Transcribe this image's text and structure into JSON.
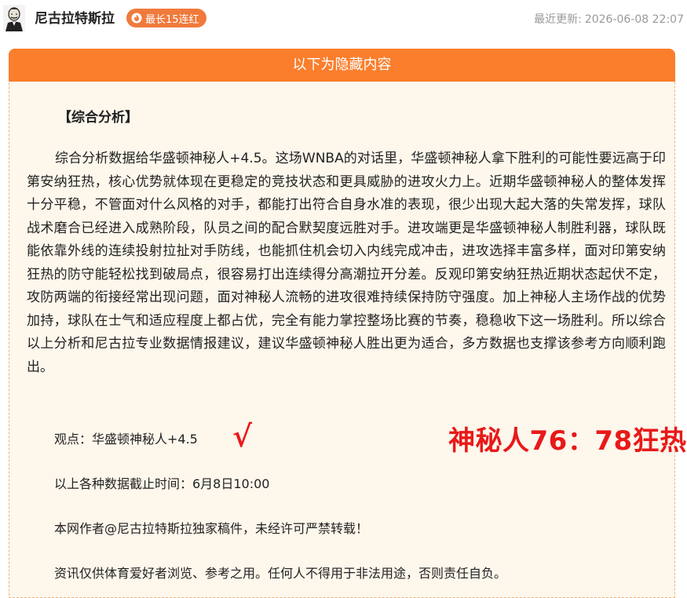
{
  "header": {
    "author": "尼古拉特斯拉",
    "streak_badge": "最长15连红",
    "updated_label": "最近更新:",
    "updated_time": "2026-06-08 22:07"
  },
  "card": {
    "hidden_banner": "以下为隐藏内容",
    "section_title": "【综合分析】",
    "analysis": "综合分析数据给华盛顿神秘人+4.5。这场WNBA的对话里，华盛顿神秘人拿下胜利的可能性要远高于印第安纳狂热，核心优势就体现在更稳定的竞技状态和更具威胁的进攻火力上。近期华盛顿神秘人的整体发挥十分平稳，不管面对什么风格的对手，都能打出符合自身水准的表现，很少出现大起大落的失常发挥，球队战术磨合已经进入成熟阶段，队员之间的配合默契度远胜对手。进攻端更是华盛顿神秘人制胜利器，球队既能依靠外线的连续投射拉扯对手防线，也能抓住机会切入内线完成冲击，进攻选择丰富多样，面对印第安纳狂热的防守能轻松找到破局点，很容易打出连续得分高潮拉开分差。反观印第安纳狂热近期状态起伏不定，攻防两端的衔接经常出现问题，面对神秘人流畅的进攻很难持续保持防守强度。加上神秘人主场作战的优势加持，球队在士气和适应程度上都占优，完全有能力掌控整场比赛的节奏，稳稳收下这一场胜利。所以综合以上分析和尼古拉专业数据情报建议，建议华盛顿神秘人胜出更为适合，多方数据也支撑该参考方向顺利跑出。",
    "opinion": "观点：华盛顿神秘人+4.5",
    "check_mark": "√",
    "result_score": "神秘人76：78狂热",
    "cutoff": "以上各种数据截止时间：6月8日10:00",
    "copyright": "本网作者@尼古拉特斯拉独家稿件，未经许可严禁转载！",
    "disclaimer": "资讯仅供体育爱好者浏览、参考之用。任何人不得用于非法用途，否则责任自负。"
  },
  "colors": {
    "accent_orange": "#fa7e2c",
    "badge_orange": "#f07a3c",
    "card_bg": "#fdf7ec",
    "result_red": "#e8191a"
  },
  "icons": {
    "avatar": "tesla-portrait-avatar",
    "badge": "flame-icon"
  }
}
